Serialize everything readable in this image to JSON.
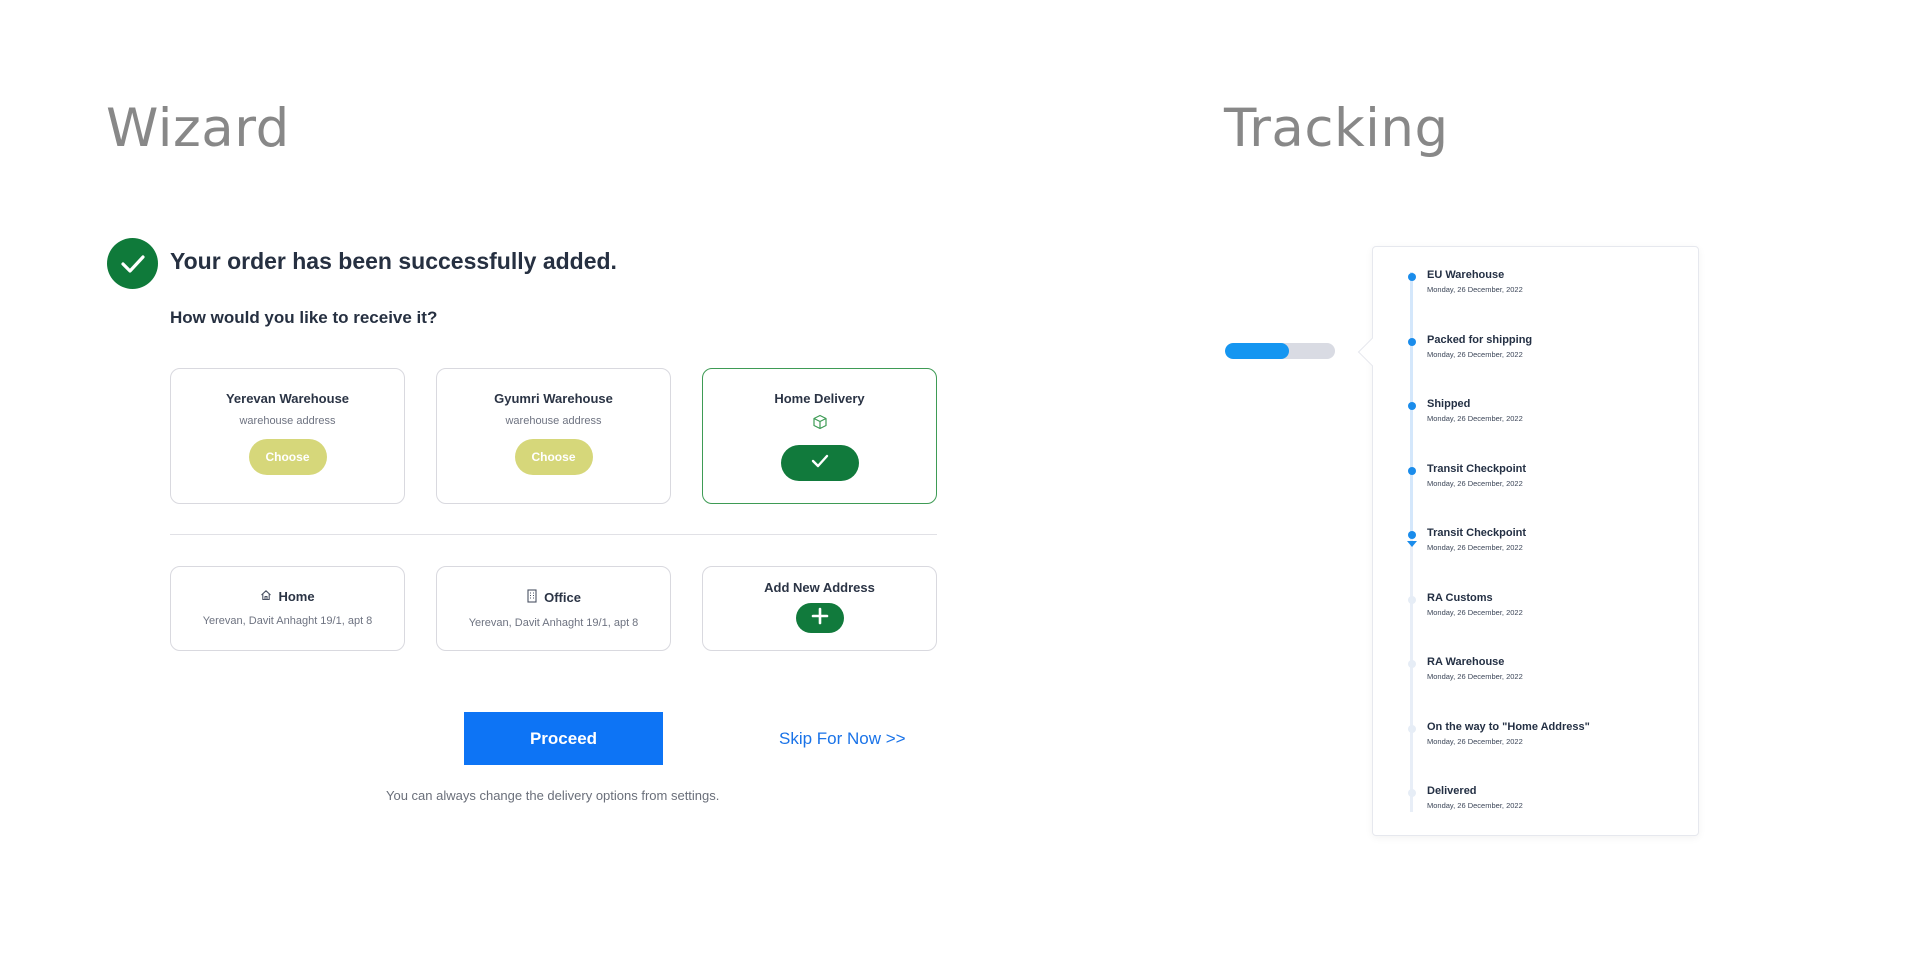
{
  "wizard": {
    "title": "Wizard",
    "success_message": "Your order has been successfully added.",
    "question": "How would you like to receive it?",
    "options": [
      {
        "title": "Yerevan Warehouse",
        "subtitle": "warehouse address",
        "button": "Choose",
        "selected": false
      },
      {
        "title": "Gyumri Warehouse",
        "subtitle": "warehouse address",
        "button": "Choose",
        "selected": false
      },
      {
        "title": "Home Delivery",
        "icon": "box-icon",
        "button_icon": "check-icon",
        "selected": true
      }
    ],
    "addresses": [
      {
        "title": "Home",
        "icon": "home-icon",
        "address": "Yerevan, Davit Anhaght 19/1, apt 8"
      },
      {
        "title": "Office",
        "icon": "building-icon",
        "address": "Yerevan, Davit Anhaght 19/1, apt 8"
      },
      {
        "title": "Add New Address",
        "icon": "plus-icon"
      }
    ],
    "proceed_label": "Proceed",
    "skip_label": "Skip For Now >>",
    "note": "You can always change the delivery options from settings."
  },
  "tracking": {
    "title": "Tracking",
    "progress_percent": 58,
    "steps": [
      {
        "label": "EU Warehouse",
        "date": "Monday, 26 December, 2022",
        "done": true
      },
      {
        "label": "Packed for shipping",
        "date": "Monday, 26 December, 2022",
        "done": true
      },
      {
        "label": "Shipped",
        "date": "Monday, 26 December, 2022",
        "done": true
      },
      {
        "label": "Transit Checkpoint",
        "date": "Monday, 26 December, 2022",
        "done": true
      },
      {
        "label": "Transit Checkpoint",
        "date": "Monday, 26 December, 2022",
        "done": true,
        "current": true
      },
      {
        "label": "RA Customs",
        "date": "Monday, 26 December, 2022",
        "done": false
      },
      {
        "label": "RA Warehouse",
        "date": "Monday, 26 December, 2022",
        "done": false
      },
      {
        "label": "On the way to \"Home Address\"",
        "date": "Monday, 26 December, 2022",
        "done": false
      },
      {
        "label": "Delivered",
        "date": "Monday, 26 December, 2022",
        "done": false
      }
    ]
  },
  "colors": {
    "success_green": "#117a3c",
    "choose_yellow": "#d6d77a",
    "primary_blue": "#0d74f5",
    "link_blue": "#1a73e8",
    "tracking_blue": "#1596f1"
  }
}
